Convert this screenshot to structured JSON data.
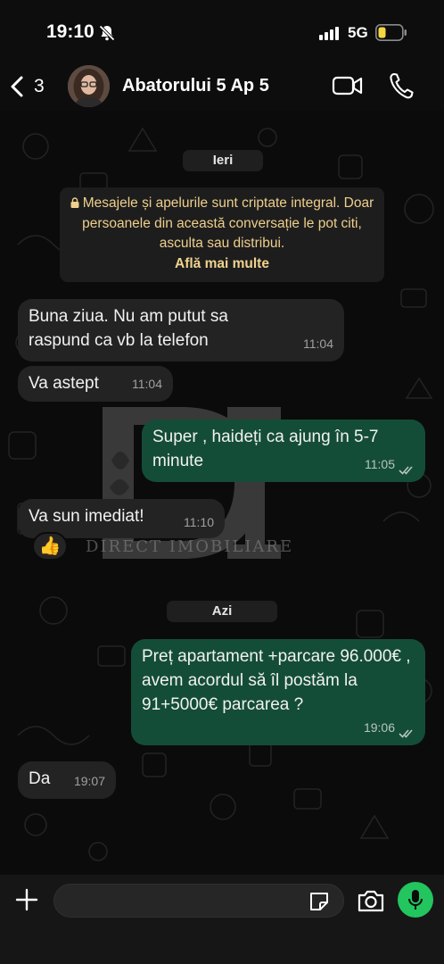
{
  "status_bar": {
    "time": "19:10",
    "network": "5G",
    "icons": [
      "bell-slash-icon",
      "signal-bars-icon",
      "battery-low-icon"
    ],
    "battery_color": "#f5d742"
  },
  "header": {
    "back_count": "3",
    "contact_name": "Abatorului 5 Ap 5",
    "icons": [
      "chevron-left-icon",
      "video-call-icon",
      "phone-icon"
    ]
  },
  "chat": {
    "date_yesterday": "Ieri",
    "encryption_notice": "Mesajele și apelurile sunt criptate integral. Doar persoanele din această conversație le pot citi, asculta sau distribui.",
    "encryption_link": "Află mai multe",
    "date_today": "Azi",
    "watermark": "DIRECT IMOBILIARE",
    "messages": [
      {
        "direction": "in",
        "text": "Buna ziua. Nu am putut sa raspund ca vb la telefon",
        "time": "11:04"
      },
      {
        "direction": "in",
        "text": "Va astept",
        "time": "11:04"
      },
      {
        "direction": "out",
        "text": "Super , haideți ca ajung în 5-7 minute",
        "time": "11:05",
        "status": "read"
      },
      {
        "direction": "in",
        "text": "Va sun imediat!",
        "time": "11:10",
        "reaction": "👍"
      },
      {
        "direction": "out",
        "text": "Preț apartament +parcare 96.000€ , avem acordul să îl postăm la 91+5000€ parcarea ?",
        "time": "19:06",
        "status": "read"
      },
      {
        "direction": "in",
        "text": "Da",
        "time": "19:07"
      }
    ]
  },
  "composer": {
    "placeholder": "",
    "icons": [
      "plus-icon",
      "sticker-icon",
      "camera-icon",
      "microphone-icon"
    ],
    "mic_color": "#22c55e"
  }
}
